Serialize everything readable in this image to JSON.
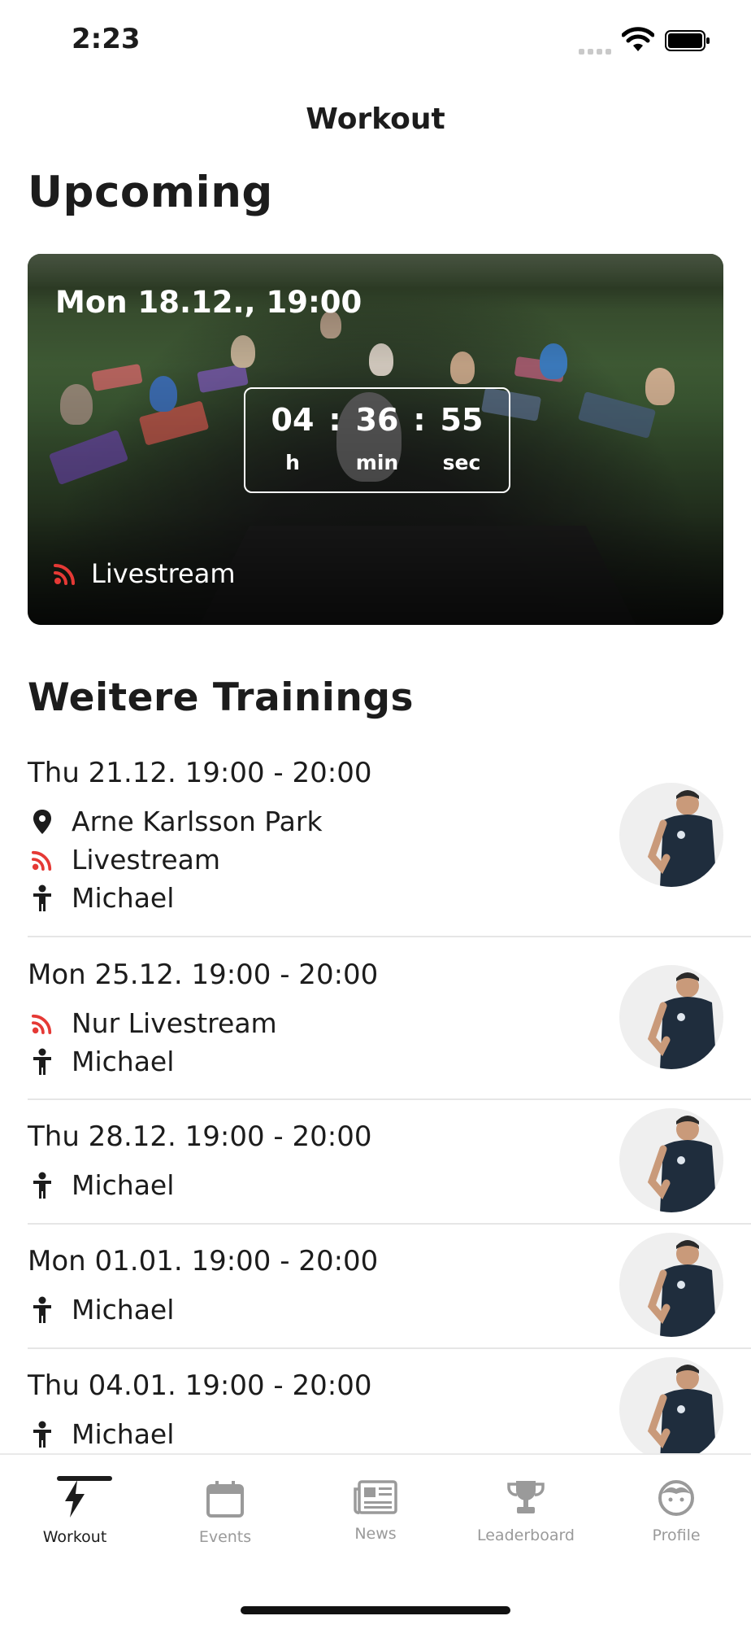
{
  "status_bar": {
    "time": "2:23"
  },
  "nav": {
    "title": "Workout"
  },
  "upcoming": {
    "heading": "Upcoming",
    "date": "Mon 18.12., 19:00",
    "countdown": {
      "hours": "04",
      "minutes": "36",
      "seconds": "55",
      "sep": ":",
      "h_label": "h",
      "min_label": "min",
      "sec_label": "sec"
    },
    "stream_label": "Livestream"
  },
  "more": {
    "heading": "Weitere Trainings",
    "items": [
      {
        "date": "Thu 21.12. 19:00 - 20:00",
        "location": "Arne Karlsson Park",
        "stream": "Livestream",
        "trainer": "Michael"
      },
      {
        "date": "Mon 25.12. 19:00 - 20:00",
        "stream": "Nur Livestream",
        "trainer": "Michael"
      },
      {
        "date": "Thu 28.12. 19:00 - 20:00",
        "trainer": "Michael"
      },
      {
        "date": "Mon 01.01. 19:00 - 20:00",
        "trainer": "Michael"
      },
      {
        "date": "Thu 04.01. 19:00 - 20:00",
        "trainer": "Michael"
      }
    ]
  },
  "tabs": [
    {
      "label": "Workout",
      "icon": "bolt-icon",
      "active": true
    },
    {
      "label": "Events",
      "icon": "calendar-icon",
      "active": false
    },
    {
      "label": "News",
      "icon": "newspaper-icon",
      "active": false
    },
    {
      "label": "Leaderboard",
      "icon": "trophy-icon",
      "active": false
    },
    {
      "label": "Profile",
      "icon": "face-icon",
      "active": false
    }
  ],
  "colors": {
    "accent_red": "#e53935",
    "text": "#1c1c1c",
    "inactive_tab": "#9a9a9a"
  }
}
